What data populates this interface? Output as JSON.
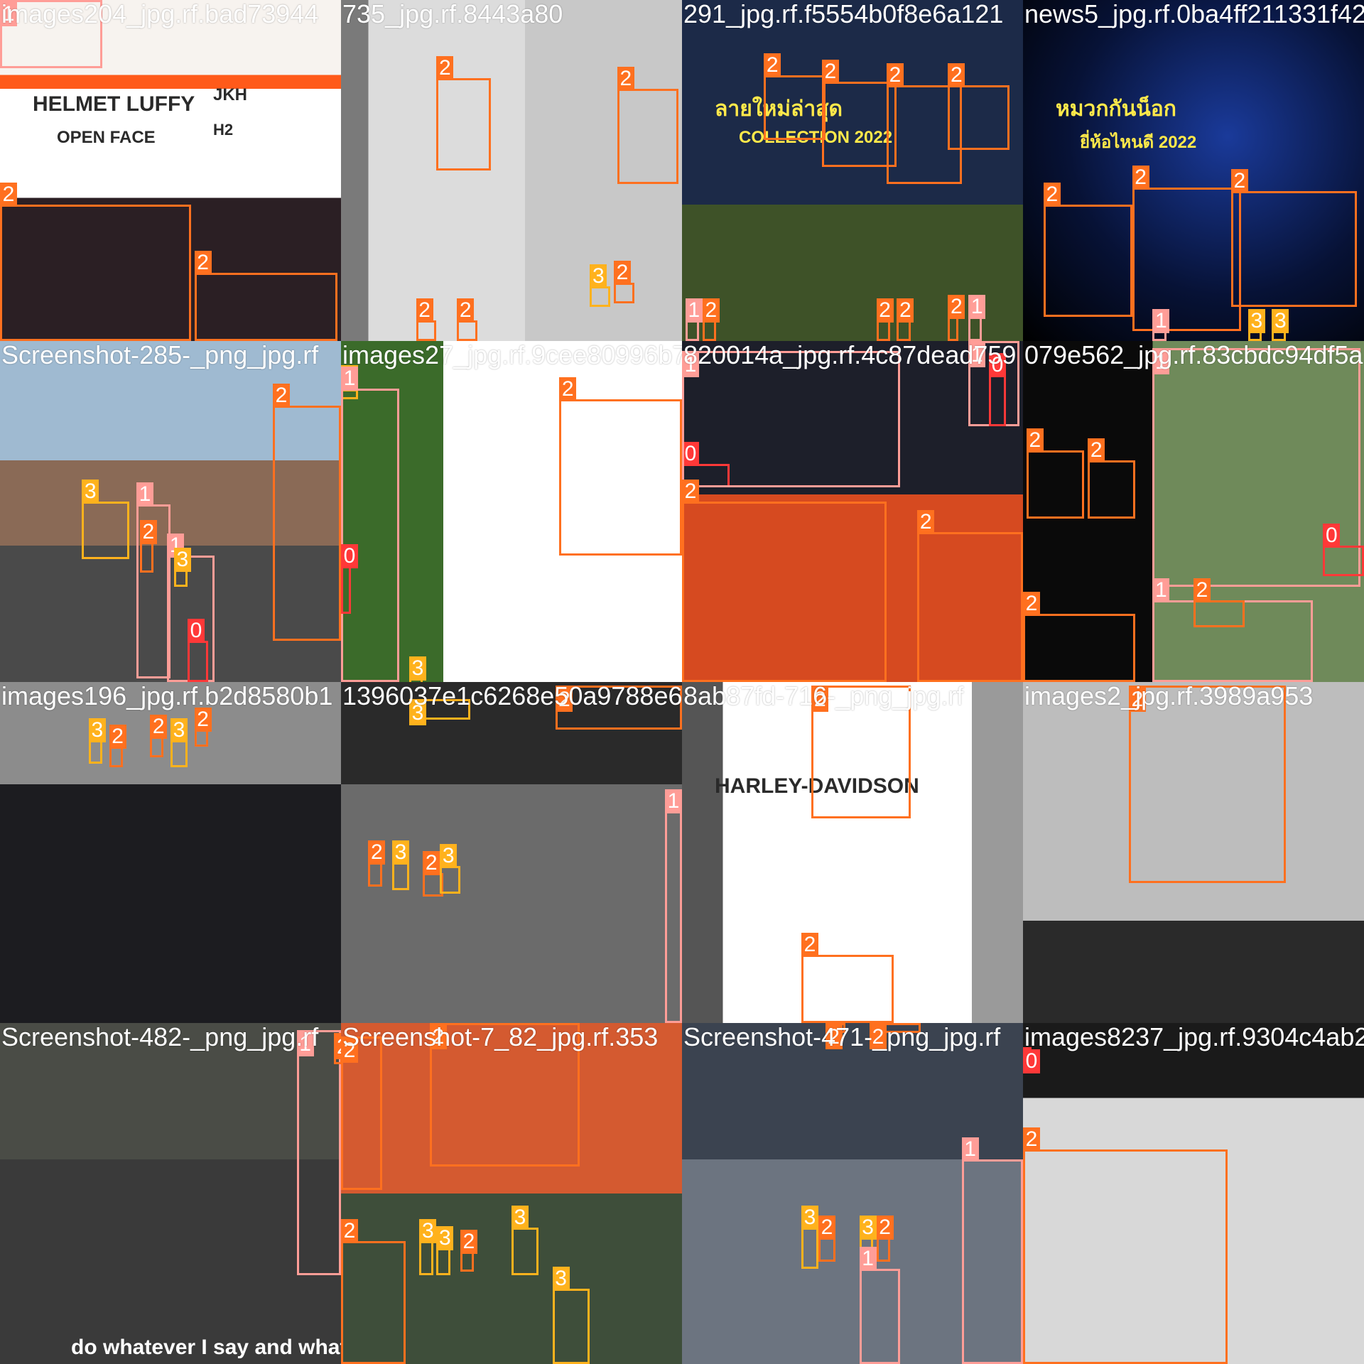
{
  "mosaic": {
    "class_colors": {
      "0": "#ff3838",
      "1": "#ff9d97",
      "2": "#ff701f",
      "3": "#ffb21d"
    },
    "tiles": [
      {
        "label": "images204_jpg.rf.bad73944",
        "scene": "helmet-ad",
        "texts": [
          "HELMET LUFFY",
          "OPEN FACE",
          "JKH",
          "H2"
        ],
        "boxes": [
          {
            "cls": "1",
            "rx": 0,
            "ry": 0,
            "rw": 0.3,
            "rh": 0.2
          },
          {
            "cls": "2",
            "rx": 0,
            "ry": 0.6,
            "rw": 0.56,
            "rh": 0.4
          },
          {
            "cls": "2",
            "rx": 0.57,
            "ry": 0.8,
            "rw": 0.42,
            "rh": 0.2
          }
        ]
      },
      {
        "label": "735_jpg.rf.8443a80",
        "scene": "studio",
        "boxes": [
          {
            "cls": "2",
            "rx": 0.28,
            "ry": 0.23,
            "rw": 0.16,
            "rh": 0.27
          },
          {
            "cls": "2",
            "rx": 0.81,
            "ry": 0.26,
            "rw": 0.18,
            "rh": 0.28
          },
          {
            "cls": "2",
            "rx": 0.22,
            "ry": 0.94,
            "rw": 0.06,
            "rh": 0.06
          },
          {
            "cls": "2",
            "rx": 0.34,
            "ry": 0.94,
            "rw": 0.06,
            "rh": 0.06
          },
          {
            "cls": "3",
            "rx": 0.73,
            "ry": 0.84,
            "rw": 0.06,
            "rh": 0.06
          },
          {
            "cls": "2",
            "rx": 0.8,
            "ry": 0.83,
            "rw": 0.06,
            "rh": 0.06
          }
        ]
      },
      {
        "label": "291_jpg.rf.f5554b0f8e6a121",
        "scene": "poster-thai",
        "texts": [
          "ลายใหม่ล่าสุด",
          "COLLECTION 2022"
        ],
        "boxes": [
          {
            "cls": "2",
            "rx": 0.24,
            "ry": 0.22,
            "rw": 0.18,
            "rh": 0.19
          },
          {
            "cls": "2",
            "rx": 0.41,
            "ry": 0.24,
            "rw": 0.22,
            "rh": 0.25
          },
          {
            "cls": "2",
            "rx": 0.6,
            "ry": 0.25,
            "rw": 0.22,
            "rh": 0.29
          },
          {
            "cls": "2",
            "rx": 0.78,
            "ry": 0.25,
            "rw": 0.18,
            "rh": 0.19
          },
          {
            "cls": "1",
            "rx": 0.01,
            "ry": 0.94,
            "rw": 0.04,
            "rh": 0.06
          },
          {
            "cls": "2",
            "rx": 0.06,
            "ry": 0.94,
            "rw": 0.04,
            "rh": 0.06
          },
          {
            "cls": "2",
            "rx": 0.57,
            "ry": 0.94,
            "rw": 0.04,
            "rh": 0.06
          },
          {
            "cls": "2",
            "rx": 0.63,
            "ry": 0.94,
            "rw": 0.04,
            "rh": 0.06
          },
          {
            "cls": "2",
            "rx": 0.78,
            "ry": 0.93,
            "rw": 0.03,
            "rh": 0.07
          },
          {
            "cls": "1",
            "rx": 0.84,
            "ry": 0.93,
            "rw": 0.04,
            "rh": 0.07
          }
        ]
      },
      {
        "label": "news5_jpg.rf.0ba4ff211331f42",
        "scene": "dark-promo",
        "texts": [
          "หมวกกันน็อก",
          "ยี่ห้อไหนดี 2022"
        ],
        "boxes": [
          {
            "cls": "2",
            "rx": 0.06,
            "ry": 0.6,
            "rw": 0.26,
            "rh": 0.33
          },
          {
            "cls": "2",
            "rx": 0.32,
            "ry": 0.55,
            "rw": 0.32,
            "rh": 0.42
          },
          {
            "cls": "2",
            "rx": 0.61,
            "ry": 0.56,
            "rw": 0.37,
            "rh": 0.34
          },
          {
            "cls": "1",
            "rx": 0.38,
            "ry": 0.97,
            "rw": 0.04,
            "rh": 0.03
          },
          {
            "cls": "3",
            "rx": 0.66,
            "ry": 0.97,
            "rw": 0.04,
            "rh": 0.03
          },
          {
            "cls": "3",
            "rx": 0.73,
            "ry": 0.97,
            "rw": 0.04,
            "rh": 0.03
          }
        ]
      },
      {
        "label": "Screenshot-285-_png_jpg.rf",
        "scene": "street",
        "boxes": [
          {
            "cls": "3",
            "rx": 0.24,
            "ry": 0.47,
            "rw": 0.14,
            "rh": 0.17
          },
          {
            "cls": "1",
            "rx": 0.4,
            "ry": 0.48,
            "rw": 0.1,
            "rh": 0.51
          },
          {
            "cls": "2",
            "rx": 0.41,
            "ry": 0.59,
            "rw": 0.04,
            "rh": 0.09
          },
          {
            "cls": "1",
            "rx": 0.49,
            "ry": 0.63,
            "rw": 0.14,
            "rh": 0.37
          },
          {
            "cls": "3",
            "rx": 0.51,
            "ry": 0.67,
            "rw": 0.04,
            "rh": 0.05
          },
          {
            "cls": "0",
            "rx": 0.55,
            "ry": 0.88,
            "rw": 0.06,
            "rh": 0.12
          },
          {
            "cls": "2",
            "rx": 0.8,
            "ry": 0.19,
            "rw": 0.2,
            "rh": 0.69
          }
        ]
      },
      {
        "label": "images27_jpg.rf.9cee80996b79",
        "scene": "portrait-blue",
        "boxes": [
          {
            "cls": "3",
            "rx": 0,
            "ry": 0.07,
            "rw": 0.05,
            "rh": 0.1
          },
          {
            "cls": "1",
            "rx": 0,
            "ry": 0.14,
            "rw": 0.17,
            "rh": 0.86
          },
          {
            "cls": "0",
            "rx": 0,
            "ry": 0.66,
            "rw": 0.03,
            "rh": 0.14
          },
          {
            "cls": "2",
            "rx": 0.64,
            "ry": 0.17,
            "rw": 0.36,
            "rh": 0.46
          },
          {
            "cls": "3",
            "rx": 0.2,
            "ry": 0.99,
            "rw": 0.04,
            "rh": 0.01
          }
        ]
      },
      {
        "label": "820014a_jpg.rf.4c87dead759",
        "scene": "moto-red",
        "boxes": [
          {
            "cls": "0",
            "rx": 0,
            "ry": 0.36,
            "rw": 0.14,
            "rh": 0.07
          },
          {
            "cls": "1",
            "rx": 0,
            "ry": 0.03,
            "rw": 0.64,
            "rh": 0.4
          },
          {
            "cls": "1",
            "rx": 0.84,
            "ry": 0.0,
            "rw": 0.15,
            "rh": 0.25
          },
          {
            "cls": "0",
            "rx": 0.9,
            "ry": 0.1,
            "rw": 0.05,
            "rh": 0.15
          },
          {
            "cls": "2",
            "rx": 0,
            "ry": 0.47,
            "rw": 0.6,
            "rh": 0.53
          },
          {
            "cls": "2",
            "rx": 0.69,
            "ry": 0.56,
            "rw": 0.31,
            "rh": 0.44
          }
        ]
      },
      {
        "label": "079e562_jpg.rf.83cbdc94df5a",
        "scene": "scooter",
        "boxes": [
          {
            "cls": "2",
            "rx": 0.01,
            "ry": 0.32,
            "rw": 0.17,
            "rh": 0.2
          },
          {
            "cls": "2",
            "rx": 0.19,
            "ry": 0.35,
            "rw": 0.14,
            "rh": 0.17
          },
          {
            "cls": "1",
            "rx": 0.38,
            "ry": 0.02,
            "rw": 0.61,
            "rh": 0.7
          },
          {
            "cls": "0",
            "rx": 0.88,
            "ry": 0.6,
            "rw": 0.12,
            "rh": 0.09
          },
          {
            "cls": "1",
            "rx": 0.38,
            "ry": 0.76,
            "rw": 0.47,
            "rh": 0.24
          },
          {
            "cls": "2",
            "rx": 0.5,
            "ry": 0.76,
            "rw": 0.15,
            "rh": 0.08
          },
          {
            "cls": "2",
            "rx": 0,
            "ry": 0.8,
            "rw": 0.33,
            "rh": 0.2
          }
        ]
      },
      {
        "label": "images196_jpg.rf.b2d8580b1",
        "scene": "traffic",
        "boxes": [
          {
            "cls": "3",
            "rx": 0.26,
            "ry": 0.17,
            "rw": 0.04,
            "rh": 0.07
          },
          {
            "cls": "2",
            "rx": 0.32,
            "ry": 0.19,
            "rw": 0.04,
            "rh": 0.06
          },
          {
            "cls": "2",
            "rx": 0.44,
            "ry": 0.16,
            "rw": 0.04,
            "rh": 0.06
          },
          {
            "cls": "3",
            "rx": 0.5,
            "ry": 0.17,
            "rw": 0.05,
            "rh": 0.08
          },
          {
            "cls": "2",
            "rx": 0.57,
            "ry": 0.14,
            "rw": 0.04,
            "rh": 0.05
          }
        ]
      },
      {
        "label": "1396037e1c6268e50a9788e6",
        "scene": "dashcam",
        "boxes": [
          {
            "cls": "3",
            "rx": 0.2,
            "ry": 0.05,
            "rw": 0.18,
            "rh": 0.06
          },
          {
            "cls": "2",
            "rx": 0.63,
            "ry": 0.01,
            "rw": 0.37,
            "rh": 0.13
          },
          {
            "cls": "2",
            "rx": 0.08,
            "ry": 0.53,
            "rw": 0.04,
            "rh": 0.07
          },
          {
            "cls": "3",
            "rx": 0.15,
            "ry": 0.53,
            "rw": 0.05,
            "rh": 0.08
          },
          {
            "cls": "2",
            "rx": 0.24,
            "ry": 0.56,
            "rw": 0.06,
            "rh": 0.07
          },
          {
            "cls": "3",
            "rx": 0.29,
            "ry": 0.54,
            "rw": 0.06,
            "rh": 0.08
          },
          {
            "cls": "1",
            "rx": 0.95,
            "ry": 0.38,
            "rw": 0.05,
            "rh": 0.62
          }
        ]
      },
      {
        "label": "8ab87fd-716-_png_jpg.rf",
        "scene": "harley",
        "texts": [
          "HARLEY-DAVIDSON"
        ],
        "boxes": [
          {
            "cls": "2",
            "rx": 0.38,
            "ry": 0.01,
            "rw": 0.29,
            "rh": 0.39
          },
          {
            "cls": "2",
            "rx": 0.35,
            "ry": 0.8,
            "rw": 0.27,
            "rh": 0.2
          }
        ]
      },
      {
        "label": "images2_jpg.rf.3989a953",
        "scene": "portrait-grey",
        "boxes": [
          {
            "cls": "2",
            "rx": 0.31,
            "ry": 0.01,
            "rw": 0.46,
            "rh": 0.58
          }
        ]
      },
      {
        "label": "Screenshot-482-_png_jpg.rf",
        "scene": "pov-road",
        "texts": [
          "do whatever I say and whatever I do"
        ],
        "boxes": [
          {
            "cls": "1",
            "rx": 0.87,
            "ry": 0.02,
            "rw": 0.13,
            "rh": 0.72
          },
          {
            "cls": "2",
            "rx": 0.98,
            "ry": 0.03,
            "rw": 0.02,
            "rh": 0.09
          }
        ]
      },
      {
        "label": "Screenshot-7_82_jpg.rf.353",
        "scene": "smile",
        "boxes": [
          {
            "cls": "2",
            "rx": 0.0,
            "ry": 0.04,
            "rw": 0.12,
            "rh": 0.45
          },
          {
            "cls": "2",
            "rx": 0.26,
            "ry": 0.0,
            "rw": 0.44,
            "rh": 0.42
          },
          {
            "cls": "2",
            "rx": 0,
            "ry": 0.64,
            "rw": 0.19,
            "rh": 0.36
          },
          {
            "cls": "3",
            "rx": 0.23,
            "ry": 0.64,
            "rw": 0.04,
            "rh": 0.1
          },
          {
            "cls": "3",
            "rx": 0.28,
            "ry": 0.66,
            "rw": 0.04,
            "rh": 0.08
          },
          {
            "cls": "2",
            "rx": 0.35,
            "ry": 0.67,
            "rw": 0.04,
            "rh": 0.06
          },
          {
            "cls": "3",
            "rx": 0.5,
            "ry": 0.6,
            "rw": 0.08,
            "rh": 0.14
          },
          {
            "cls": "3",
            "rx": 0.62,
            "ry": 0.78,
            "rw": 0.11,
            "rh": 0.22
          }
        ]
      },
      {
        "label": "Screenshot-471-_png_jpg.rf",
        "scene": "crowd",
        "boxes": [
          {
            "cls": "2",
            "rx": 0.42,
            "ry": 0.0,
            "rw": 0.06,
            "rh": 0.03
          },
          {
            "cls": "2",
            "rx": 0.55,
            "ry": 0.0,
            "rw": 0.15,
            "rh": 0.03
          },
          {
            "cls": "1",
            "rx": 0.82,
            "ry": 0.4,
            "rw": 0.18,
            "rh": 0.6
          },
          {
            "cls": "3",
            "rx": 0.35,
            "ry": 0.6,
            "rw": 0.05,
            "rh": 0.12
          },
          {
            "cls": "2",
            "rx": 0.4,
            "ry": 0.63,
            "rw": 0.05,
            "rh": 0.07
          },
          {
            "cls": "3",
            "rx": 0.52,
            "ry": 0.63,
            "rw": 0.04,
            "rh": 0.08
          },
          {
            "cls": "2",
            "rx": 0.57,
            "ry": 0.63,
            "rw": 0.04,
            "rh": 0.07
          },
          {
            "cls": "1",
            "rx": 0.52,
            "ry": 0.72,
            "rw": 0.12,
            "rh": 0.28
          }
        ]
      },
      {
        "label": "images8237_jpg.rf.9304c4ab2",
        "scene": "closeup-white",
        "boxes": [
          {
            "cls": "0",
            "rx": 0,
            "ry": 0.07,
            "rw": 0.02,
            "rh": 0.07
          },
          {
            "cls": "2",
            "rx": 0,
            "ry": 0.37,
            "rw": 0.6,
            "rh": 0.63
          }
        ]
      }
    ]
  }
}
